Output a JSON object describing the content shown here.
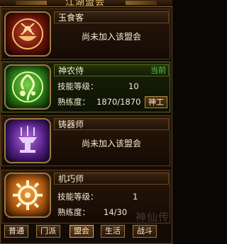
{
  "header": {
    "title": "江湖盟会"
  },
  "guilds": [
    {
      "name": "玉食客",
      "status": "尚未加入该盟会",
      "emblem_icon": "bowl-icon"
    },
    {
      "name": "神农侍",
      "current_label": "当前",
      "skill_label": "技能等级：",
      "skill_value": "10",
      "proficiency_label": "熟练度：",
      "proficiency_value": "1870/1870",
      "divine_button": "神工",
      "emblem_icon": "herb-icon"
    },
    {
      "name": "铸器师",
      "status": "尚未加入该盟会",
      "emblem_icon": "anvil-icon"
    },
    {
      "name": "机巧师",
      "skill_label": "技能等级：",
      "skill_value": "1",
      "proficiency_label": "熟练度：",
      "proficiency_value": "14/30",
      "emblem_icon": "gear-icon"
    }
  ],
  "tabs": [
    {
      "label": "普通"
    },
    {
      "label": "门派"
    },
    {
      "label": "盟会",
      "selected": true
    },
    {
      "label": "生活"
    },
    {
      "label": "战斗"
    }
  ],
  "watermark": "神仙传"
}
